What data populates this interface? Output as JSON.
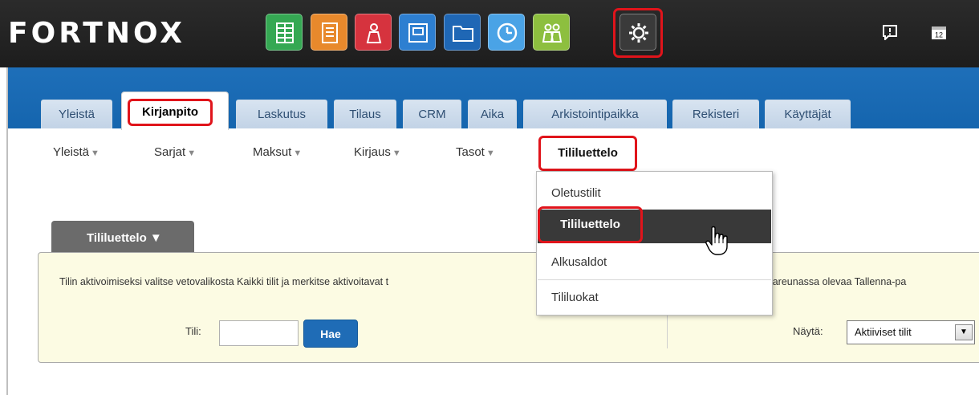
{
  "header": {
    "logo": "FORTNOX",
    "apps": [
      {
        "name": "ledger-app-icon",
        "color": "#35a853"
      },
      {
        "name": "invoice-app-icon",
        "color": "#e8892c"
      },
      {
        "name": "user-app-icon",
        "color": "#d6333e"
      },
      {
        "name": "screen-app-icon",
        "color": "#2d7fd1"
      },
      {
        "name": "folder-app-icon",
        "color": "#1f67b5"
      },
      {
        "name": "clock-app-icon",
        "color": "#4aa3e6"
      },
      {
        "name": "people-app-icon",
        "color": "#8dbf3f"
      },
      {
        "name": "settings-app-icon",
        "color": "#3a3a3a"
      }
    ],
    "calendar_day": "12"
  },
  "tabs": [
    {
      "label": "Yleistä"
    },
    {
      "label": "Kirjanpito"
    },
    {
      "label": "Laskutus"
    },
    {
      "label": "Tilaus"
    },
    {
      "label": "CRM"
    },
    {
      "label": "Aika"
    },
    {
      "label": "Arkistointipaikka"
    },
    {
      "label": "Rekisteri"
    },
    {
      "label": "Käyttäjät"
    }
  ],
  "submenu": [
    {
      "label": "Yleistä"
    },
    {
      "label": "Sarjat"
    },
    {
      "label": "Maksut"
    },
    {
      "label": "Kirjaus"
    },
    {
      "label": "Tasot"
    },
    {
      "label": "Tililuettelo"
    }
  ],
  "dropdown": [
    {
      "label": "Oletustilit"
    },
    {
      "label": "Tililuettelo"
    },
    {
      "label": "Alkusaldot"
    },
    {
      "label": "Tililuokat"
    }
  ],
  "panel": {
    "tab_label": "Tililuettelo ▼",
    "info_text": "Tilin aktivoimiseksi valitse vetovalikosta Kaikki tilit ja merkitse aktivoitavat t",
    "info_text_right": "alareunassa olevaa Tallenna-pa",
    "account_label": "Tili:",
    "search_button": "Hae",
    "show_label": "Näytä:",
    "show_value": "Aktiiviset tilit"
  },
  "colors": {
    "highlight": "#e0141b",
    "brand_blue": "#1565ae",
    "header_dark": "#1d1d1d"
  }
}
